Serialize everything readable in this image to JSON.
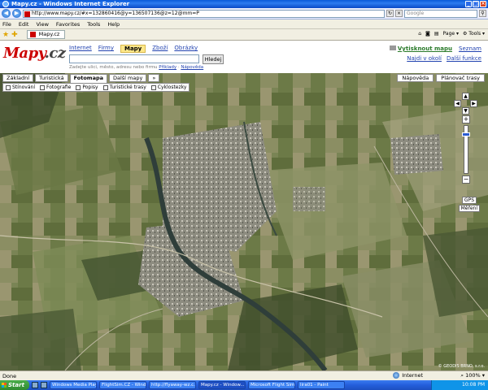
{
  "window": {
    "title": "Mapy.cz - Windows Internet Explorer"
  },
  "addressbar": {
    "url": "http://www.mapy.cz/#x=132860416@y=136507136@z=12@mm=P",
    "search_placeholder": "Google"
  },
  "menu": [
    "File",
    "Edit",
    "View",
    "Favorites",
    "Tools",
    "Help"
  ],
  "tab": {
    "label": "Mapy.cz"
  },
  "commandbar": {
    "page_label": "Page",
    "tools_label": "Tools"
  },
  "site": {
    "logo_main": "Mapy",
    "logo_tld": ".cz",
    "services": [
      "Internet",
      "Firmy",
      "Mapy",
      "Zboží",
      "Obrázky"
    ],
    "active_service": "Mapy",
    "search_button": "Hledej",
    "search_hint": "Zadejte ulici, město, adresu nebo firmu",
    "search_hint_links": [
      "Příklady",
      "Nápověda"
    ],
    "right_links": {
      "print": "Vytisknout mapu",
      "list": "Seznam",
      "find_in_area": "Najdi v okolí",
      "more": "Další funkce"
    }
  },
  "map": {
    "tabs": [
      "Základní",
      "Turistická",
      "Fotomapa",
      "Další mapy",
      "»"
    ],
    "active_tab": "Fotomapa",
    "layers": [
      "Stínování",
      "Fotografie",
      "Popisy",
      "Turistické trasy",
      "Cyklostezky"
    ],
    "right_buttons": [
      "Nápověda",
      "Plánovač trasy"
    ],
    "extra_buttons": [
      "GPS",
      "Měření"
    ],
    "copyright": "© GEODIS BRNO, s.r.o."
  },
  "statusbar": {
    "text": "Done",
    "zone": "Internet",
    "zoom": "100%"
  },
  "taskbar": {
    "start": "Start",
    "items": [
      "Windows Media Player",
      "FlightSim.CZ - Wind...",
      "http://flyaway-wz.c...",
      "Mapy.cz - Window...",
      "Microsoft Flight Simu...",
      "lira01 - Paint"
    ],
    "active_item": "Mapy.cz - Window...",
    "clock": "10:08 PM"
  }
}
